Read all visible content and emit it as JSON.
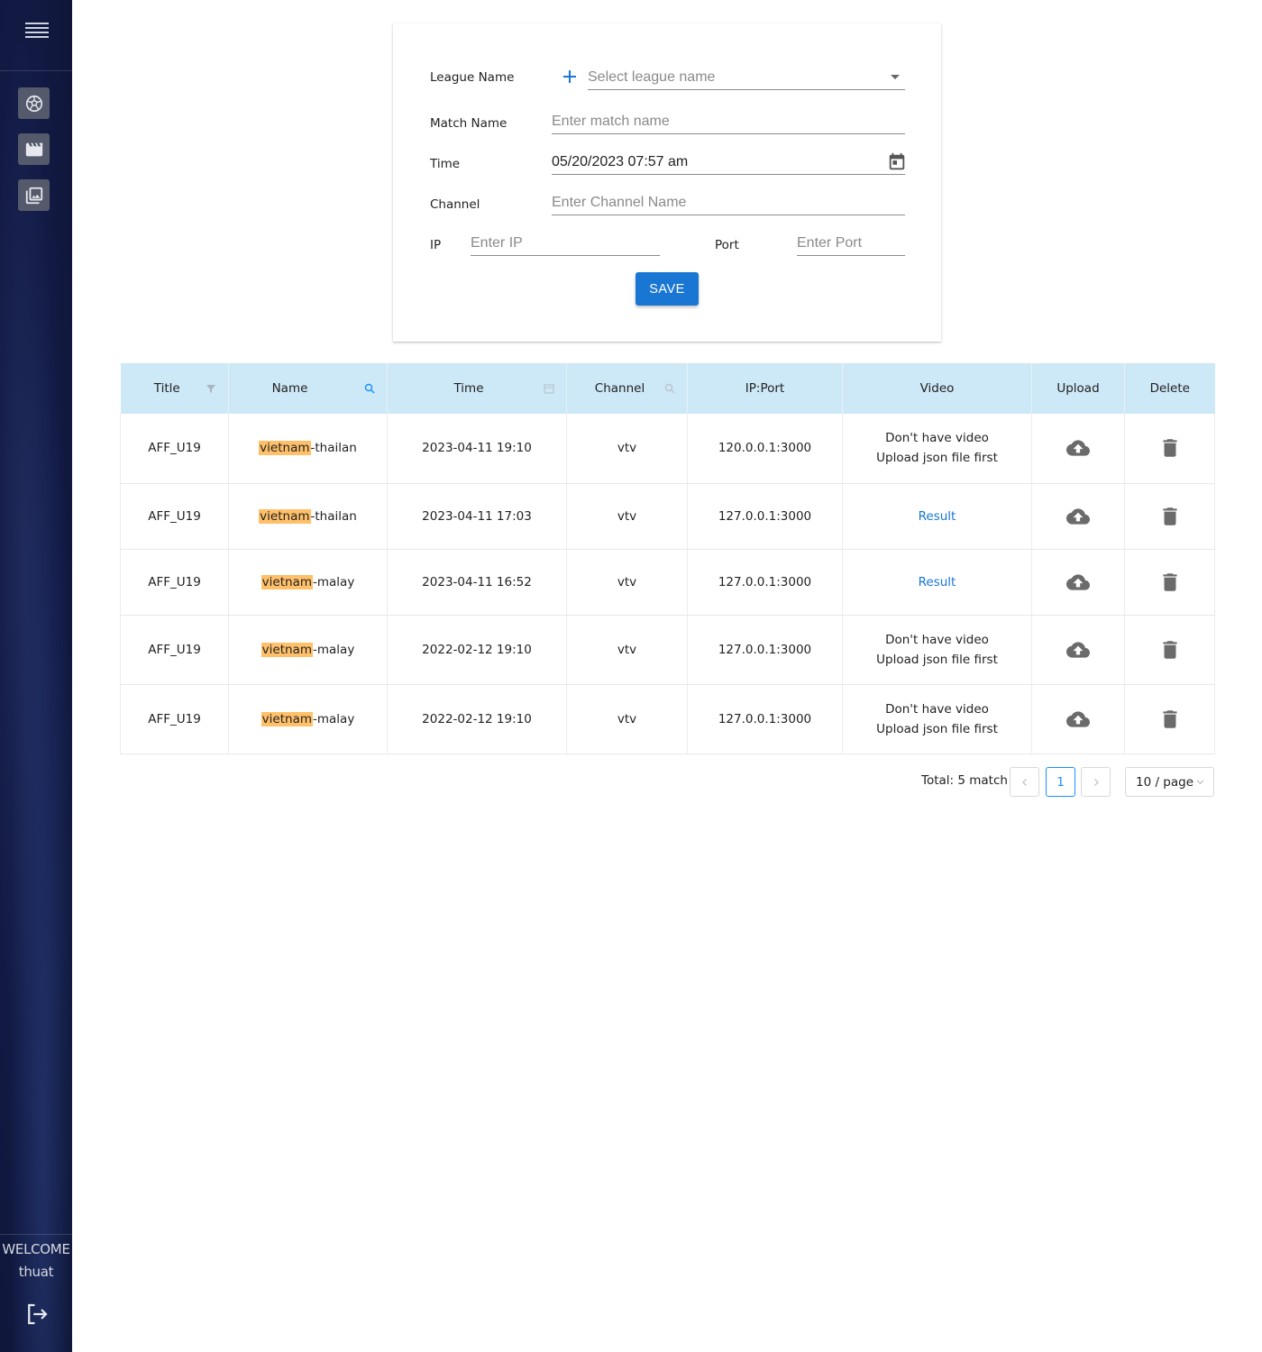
{
  "sidebar": {
    "icons": [
      "menu-icon",
      "soccer-ball-icon",
      "movie-clapper-icon",
      "photo-library-icon"
    ],
    "welcome_label": "WELCOME",
    "username": "thuat",
    "logout_icon": "logout-icon"
  },
  "form": {
    "league_label": "League Name",
    "league_placeholder": "Select league name",
    "match_label": "Match Name",
    "match_placeholder": "Enter match name",
    "time_label": "Time",
    "time_value": "05/20/2023 07:57 am",
    "channel_label": "Channel",
    "channel_placeholder": "Enter Channel Name",
    "ip_label": "IP",
    "ip_placeholder": "Enter IP",
    "port_label": "Port",
    "port_placeholder": "Enter Port",
    "save_label": "SAVE"
  },
  "table": {
    "headers": {
      "title": "Title",
      "name": "Name",
      "time": "Time",
      "channel": "Channel",
      "ipport": "IP:Port",
      "video": "Video",
      "upload": "Upload",
      "delete": "Delete"
    },
    "highlight": "vietnam",
    "rows": [
      {
        "title": "AFF_U19",
        "name_hl": "vietnam",
        "name_rest": "-thailan",
        "time": "2023-04-11 19:10",
        "channel": "vtv",
        "ipport": "120.0.0.1:3000",
        "video_line1": "Don't have video",
        "video_line2": "Upload json file first"
      },
      {
        "title": "AFF_U19",
        "name_hl": "vietnam",
        "name_rest": "-thailan",
        "time": "2023-04-11 17:03",
        "channel": "vtv",
        "ipport": "127.0.0.1:3000",
        "video_result": "Result"
      },
      {
        "title": "AFF_U19",
        "name_hl": "vietnam",
        "name_rest": "-malay",
        "time": "2023-04-11 16:52",
        "channel": "vtv",
        "ipport": "127.0.0.1:3000",
        "video_result": "Result"
      },
      {
        "title": "AFF_U19",
        "name_hl": "vietnam",
        "name_rest": "-malay",
        "time": "2022-02-12 19:10",
        "channel": "vtv",
        "ipport": "127.0.0.1:3000",
        "video_line1": "Don't have video",
        "video_line2": "Upload json file first"
      },
      {
        "title": "AFF_U19",
        "name_hl": "vietnam",
        "name_rest": "-malay",
        "time": "2022-02-12 19:10",
        "channel": "vtv",
        "ipport": "127.0.0.1:3000",
        "video_line1": "Don't have video",
        "video_line2": "Upload json file first"
      }
    ]
  },
  "pagination": {
    "total": "Total: 5 match",
    "current_page": "1",
    "page_size": "10 / page"
  },
  "colors": {
    "primary": "#1976d2",
    "header_bg": "#cde8f7",
    "highlight": "#ffc069",
    "sidebar_bg": "#121a44"
  }
}
